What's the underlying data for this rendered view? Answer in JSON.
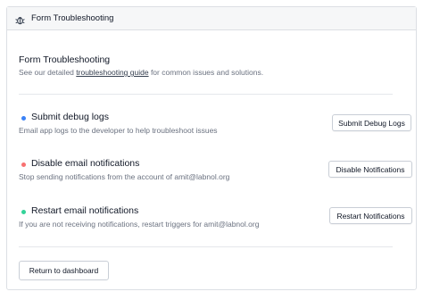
{
  "header": {
    "title": "Form Troubleshooting",
    "icon": "bug-icon"
  },
  "intro": {
    "title": "Form Troubleshooting",
    "desc_before": "See our detailed ",
    "link_text": "troubleshooting guide",
    "desc_after": " for common issues and solutions."
  },
  "items": [
    {
      "label": "Submit debug logs",
      "desc": "Email app logs to the developer to help troubleshoot issues",
      "button": "Submit Debug Logs",
      "dot_color": "#3b82f6"
    },
    {
      "label": "Disable email notifications",
      "desc": "Stop sending notifications from the account of amit@labnol.org",
      "button": "Disable Notifications",
      "dot_color": "#f87171"
    },
    {
      "label": "Restart email notifications",
      "desc": "If you are not receiving notifications, restart triggers for amit@labnol.org",
      "button": "Restart Notifications",
      "dot_color": "#34d399"
    }
  ],
  "footer": {
    "back_button": "Return to dashboard"
  }
}
